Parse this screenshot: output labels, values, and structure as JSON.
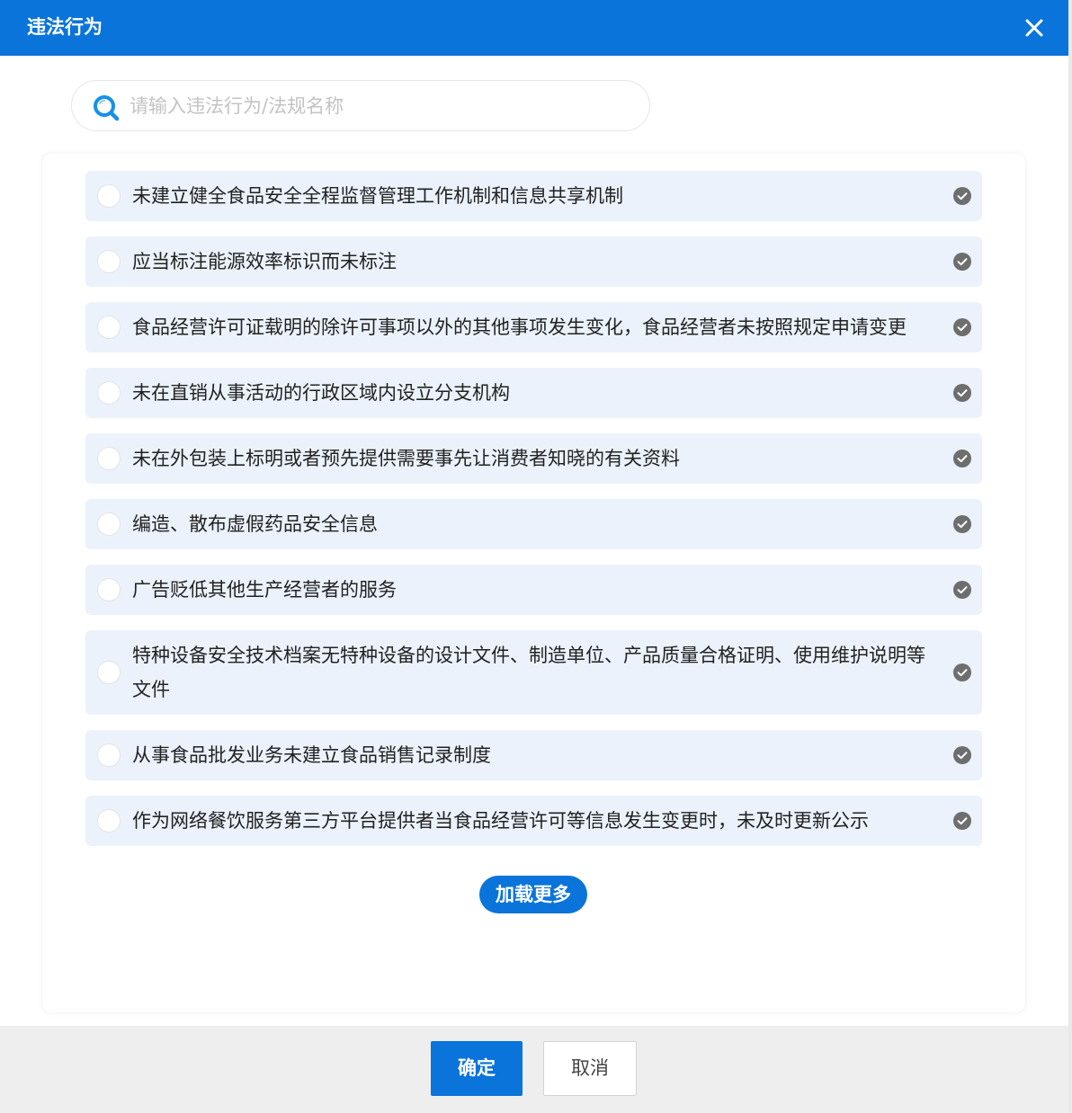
{
  "dialog": {
    "title": "违法行为",
    "close_icon": "close-icon"
  },
  "search": {
    "icon": "search-icon",
    "placeholder": "请输入违法行为/法规名称",
    "value": ""
  },
  "items": [
    {
      "label": "未建立健全食品安全全程监督管理工作机制和信息共享机制",
      "selected": false
    },
    {
      "label": "应当标注能源效率标识而未标注",
      "selected": false
    },
    {
      "label": "食品经营许可证载明的除许可事项以外的其他事项发生变化，食品经营者未按照规定申请变更",
      "selected": false
    },
    {
      "label": "未在直销从事活动的行政区域内设立分支机构",
      "selected": false
    },
    {
      "label": "未在外包装上标明或者预先提供需要事先让消费者知晓的有关资料",
      "selected": false
    },
    {
      "label": "编造、散布虚假药品安全信息",
      "selected": false
    },
    {
      "label": "广告贬低其他生产经营者的服务",
      "selected": false
    },
    {
      "label": "特种设备安全技术档案无特种设备的设计文件、制造单位、产品质量合格证明、使用维护说明等文件",
      "selected": false
    },
    {
      "label": "从事食品批发业务未建立食品销售记录制度",
      "selected": false
    },
    {
      "label": "作为网络餐饮服务第三方平台提供者当食品经营许可等信息发生变更时，未及时更新公示",
      "selected": false
    }
  ],
  "load_more_label": "加载更多",
  "footer": {
    "ok_label": "确定",
    "cancel_label": "取消"
  },
  "colors": {
    "primary": "#0a74da",
    "item_bg": "#ebf2fb",
    "check_icon": "#6e6e6e"
  }
}
